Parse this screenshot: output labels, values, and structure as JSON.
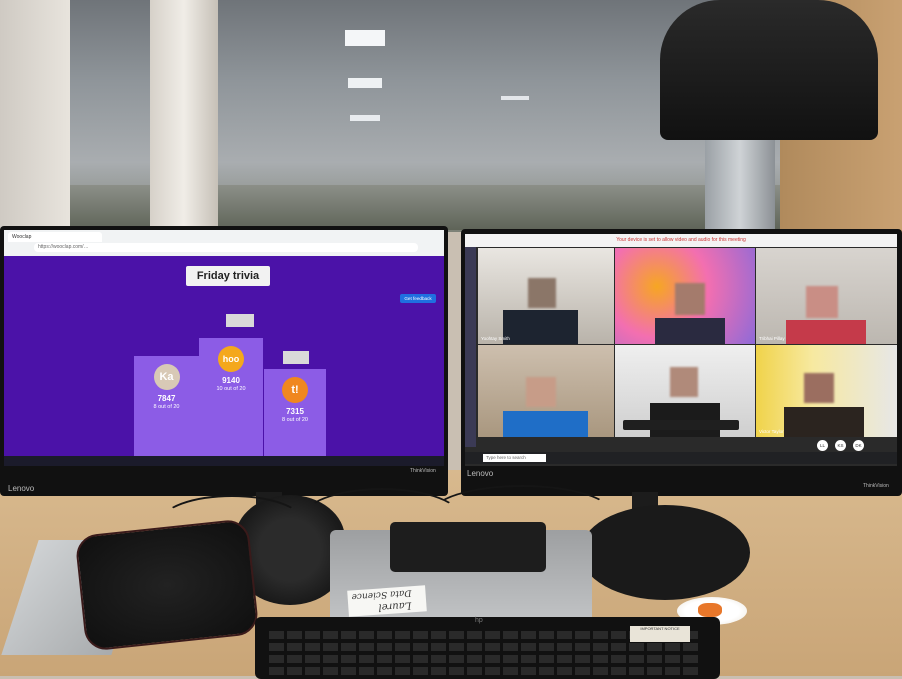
{
  "left_screen": {
    "browser_tab": "Wooclap",
    "url": "https://wooclap.com/…",
    "quiz_title": "Friday trivia",
    "feedback_button": "Get feedback",
    "podium": [
      {
        "rank": 2,
        "avatar": "Ka",
        "score": "7847",
        "correct": "8 out of 20",
        "color": "#d8c9b6"
      },
      {
        "rank": 1,
        "avatar": "hoo",
        "score": "9140",
        "correct": "10 out of 20",
        "color": "#f4a81c"
      },
      {
        "rank": 3,
        "avatar": "t!",
        "score": "7315",
        "correct": "8 out of 20",
        "color": "#f0871f"
      }
    ]
  },
  "right_screen": {
    "banner": "Your device is set to allow video and audio for this meeting",
    "participants": [
      {
        "label": "Yoohtay Smith"
      },
      {
        "label": ""
      },
      {
        "label": "Tribhai Pillay"
      },
      {
        "label": ""
      },
      {
        "label": ""
      },
      {
        "label": "Victor Taylor"
      }
    ],
    "taskbar_search": "Type here to search",
    "chips": [
      "LL",
      "KS",
      "DK"
    ]
  },
  "monitors": {
    "left_brand": "Lenovo",
    "left_model": "ThinkVision",
    "right_brand": "Lenovo",
    "right_model": "ThinkVision"
  },
  "sticky_note": {
    "line1": "Data Science",
    "line2": "Laurel"
  },
  "keyboard": {
    "brand": "hp",
    "notice": "IMPORTANT NOTICE"
  },
  "colors": {
    "quiz_background": "#4b12a8",
    "podium": "#8c5ce6",
    "desk": "#d4b387"
  }
}
